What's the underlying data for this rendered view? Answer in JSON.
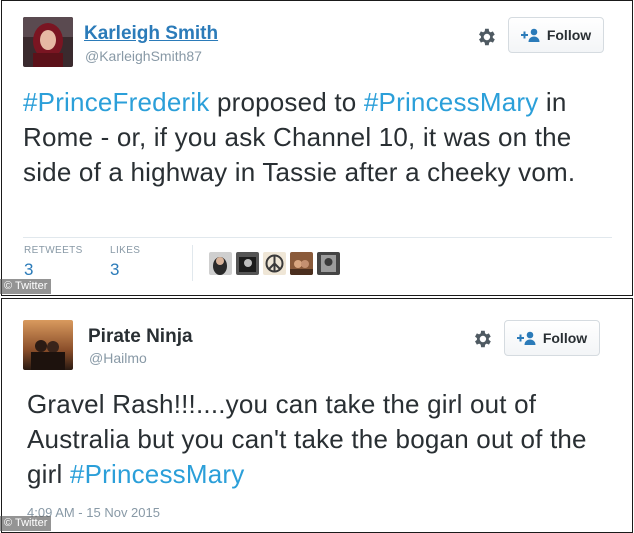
{
  "tweets": [
    {
      "display_name": "Karleigh Smith",
      "handle": "@KarleighSmith87",
      "follow_label": "Follow",
      "text_parts": [
        {
          "text": "#PrinceFrederik",
          "hashtag": true
        },
        {
          "text": " proposed to ",
          "hashtag": false
        },
        {
          "text": "#PrincessMary",
          "hashtag": true
        },
        {
          "text": " in Rome - or, if you ask Channel 10, it was on the side of a highway in Tassie after a cheeky vom.",
          "hashtag": false
        }
      ],
      "stats": {
        "retweets_label": "RETWEETS",
        "retweets_value": "3",
        "likes_label": "LIKES",
        "likes_value": "3"
      }
    },
    {
      "display_name": "Pirate Ninja",
      "handle": "@Hailmo",
      "follow_label": "Follow",
      "text_parts": [
        {
          "text": "Gravel Rash!!!....you can take the girl out of Australia but you can't take the bogan out of the girl ",
          "hashtag": false
        },
        {
          "text": "#PrincessMary",
          "hashtag": true
        }
      ],
      "timestamp": "4:09 AM - 15 Nov 2015"
    }
  ],
  "watermark": "© Twitter",
  "icons": {
    "settings": "gear-icon",
    "follow": "add-user-icon"
  },
  "colors": {
    "link": "#2b7bb9",
    "hashtag": "#2b9fd9",
    "muted": "#8899a6"
  }
}
